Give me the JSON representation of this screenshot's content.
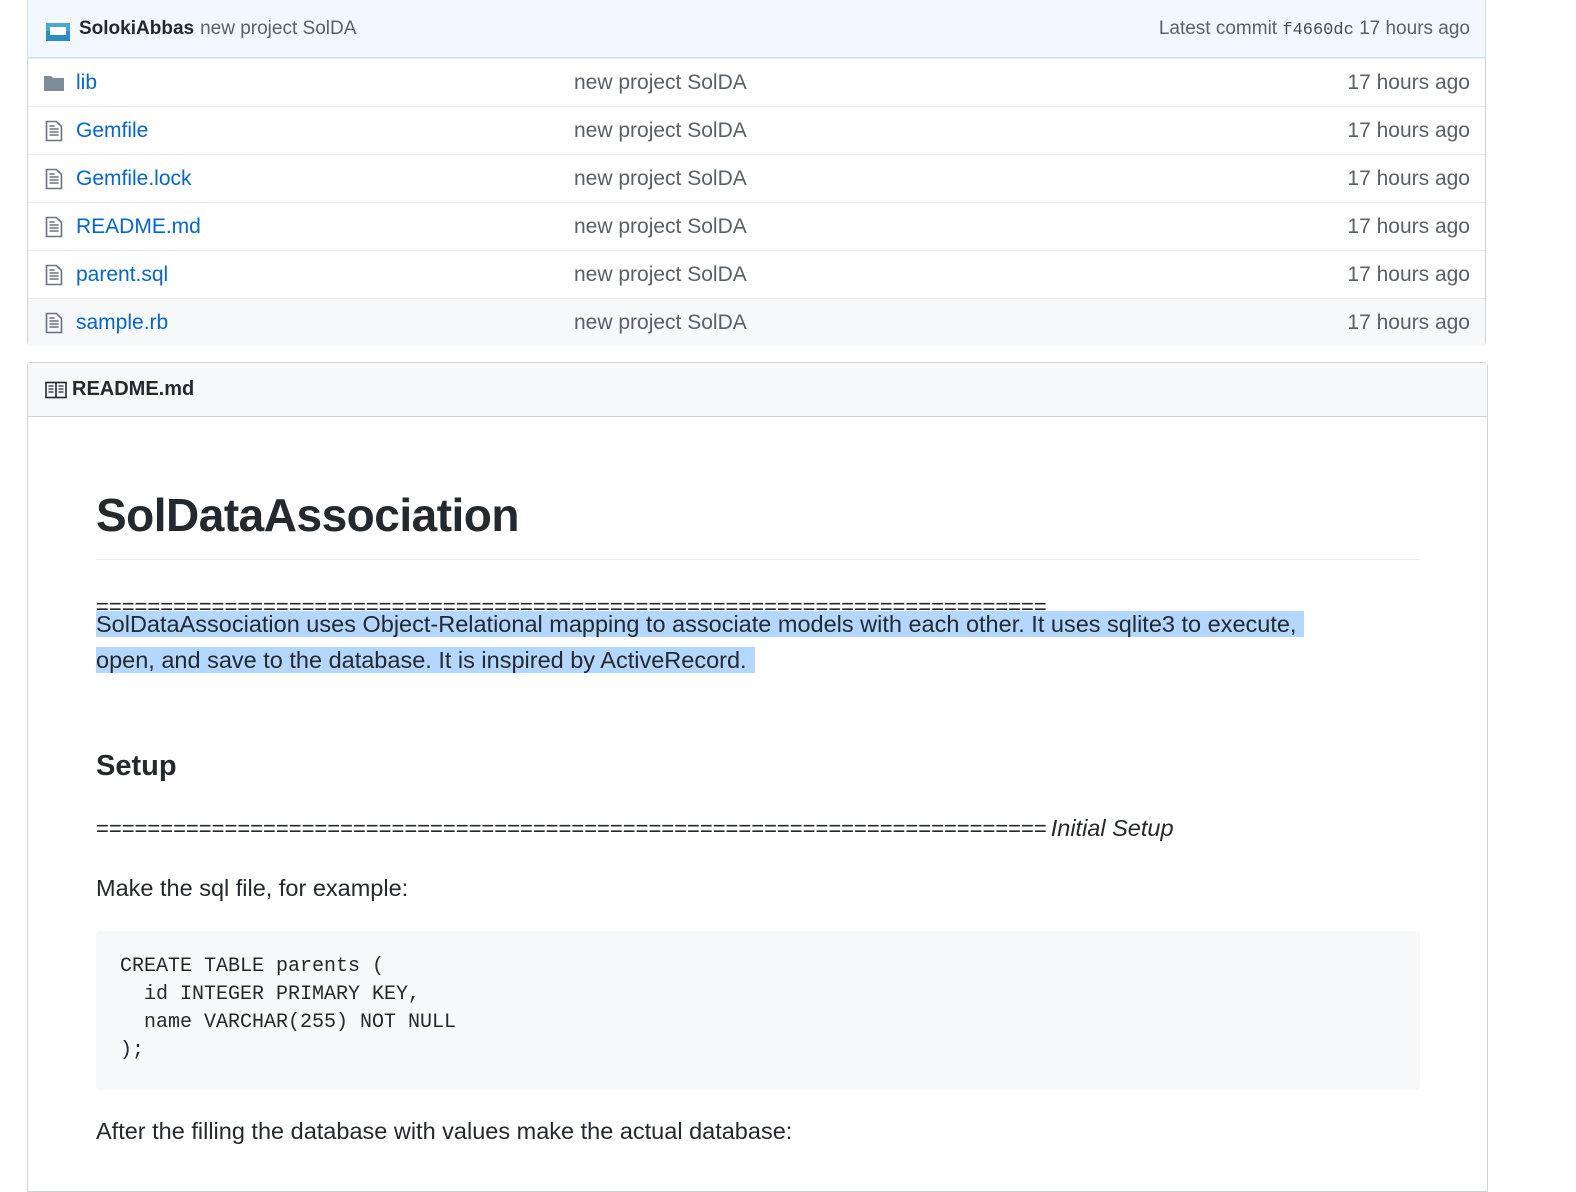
{
  "commit_bar": {
    "author": "SolokiAbbas",
    "message": "new project SolDA",
    "latest_commit_label": "Latest commit",
    "sha": "f4660dc",
    "age": "17 hours ago"
  },
  "files": [
    {
      "type": "directory",
      "name": "lib",
      "message": "new project SolDA",
      "age": "17 hours ago"
    },
    {
      "type": "file",
      "name": "Gemfile",
      "message": "new project SolDA",
      "age": "17 hours ago"
    },
    {
      "type": "file",
      "name": "Gemfile.lock",
      "message": "new project SolDA",
      "age": "17 hours ago"
    },
    {
      "type": "file",
      "name": "README.md",
      "message": "new project SolDA",
      "age": "17 hours ago"
    },
    {
      "type": "file",
      "name": "parent.sql",
      "message": "new project SolDA",
      "age": "17 hours ago"
    },
    {
      "type": "file",
      "name": "sample.rb",
      "message": "new project SolDA",
      "age": "17 hours ago"
    }
  ],
  "readme": {
    "header_title": "README.md",
    "title": "SolDataAssociation",
    "rule_1": "==========================================================================",
    "intro_line_1": "SolDataAssociation uses Object-Relational mapping to associate models with each other. It uses sqlite3 to execute,",
    "intro_line_2": "open, and save to the database. It is inspired by ActiveRecord.",
    "setup_heading": "Setup",
    "rule_2": "==========================================================================",
    "rule_2_label": "Initial Setup",
    "make_sql_text": "Make the sql file, for example:",
    "code": "CREATE TABLE parents (\n  id INTEGER PRIMARY KEY,\n  name VARCHAR(255) NOT NULL\n);",
    "after_text": "After the filling the database with values make the actual database:"
  },
  "colors": {
    "link": "#0366d6",
    "commit_bar_bg": "#f1f8ff",
    "selection": "#b3d7fe",
    "muted_text": "#586069"
  },
  "icons": {
    "directory": "folder-icon",
    "file": "file-text-icon",
    "readme": "book-icon"
  }
}
